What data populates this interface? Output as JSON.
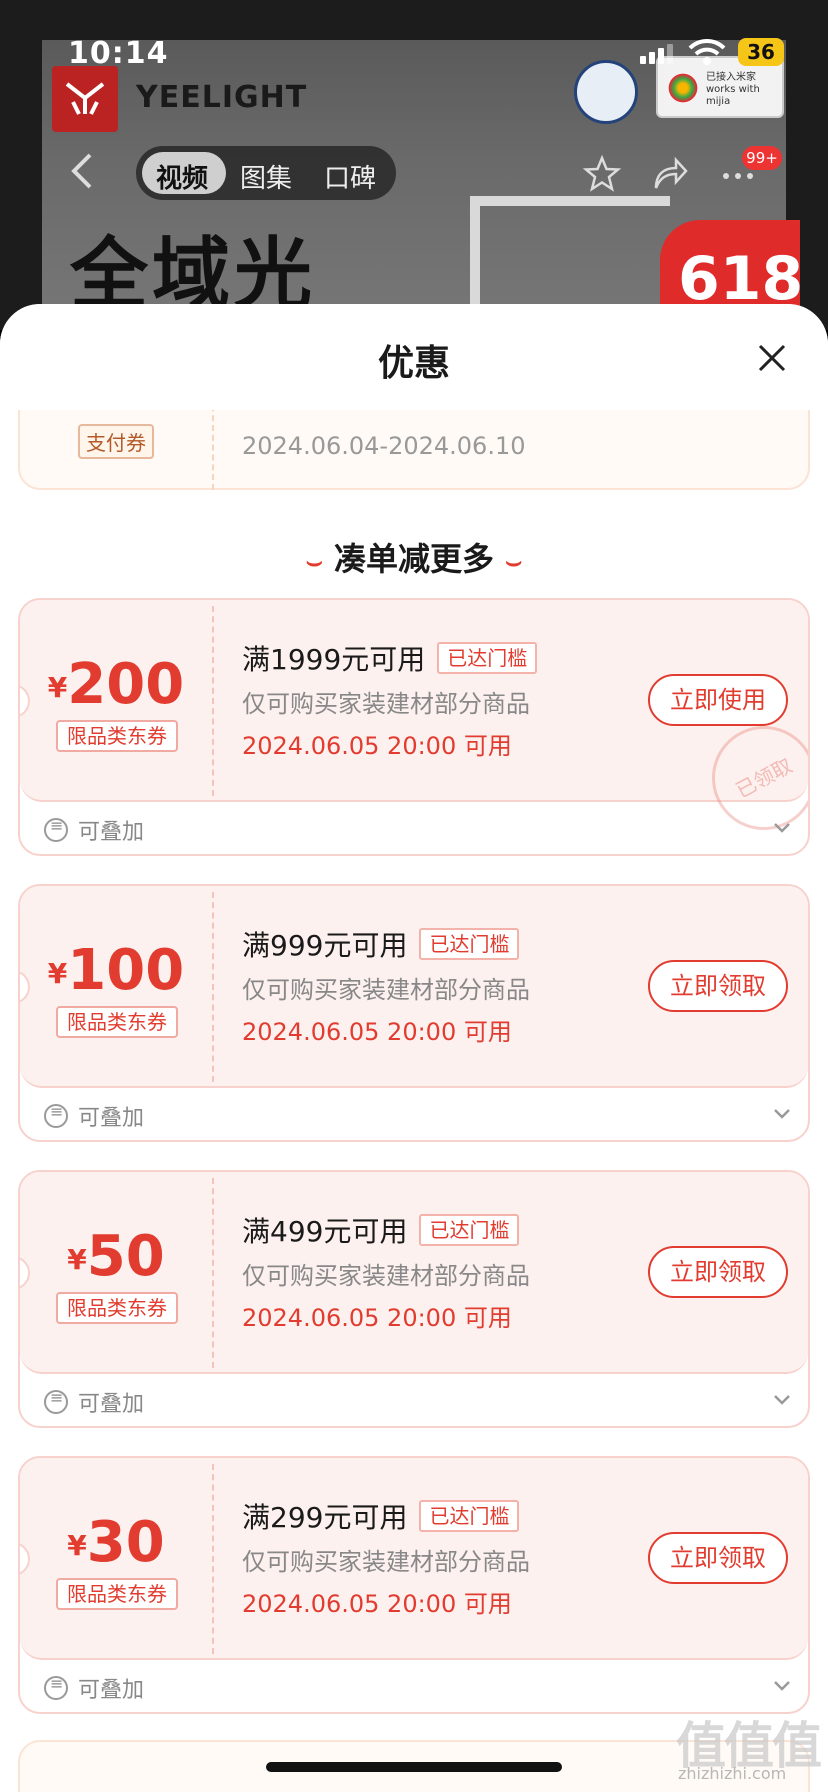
{
  "status": {
    "time": "10:14",
    "battery": "36"
  },
  "product": {
    "brand": "YEELIGHT",
    "certification": "works with mijia",
    "certification_sub": "已接入米家",
    "tabs": [
      {
        "label": "视频"
      },
      {
        "label": "图集"
      },
      {
        "label": "口碑"
      }
    ],
    "notifications": "99+",
    "banner_text": "全域光",
    "promo": "618"
  },
  "sheet": {
    "title": "优惠",
    "partial_card": {
      "tag": "支付券",
      "date": "2024.06.04-2024.06.10"
    },
    "section_title": "凑单减更多",
    "coupons": [
      {
        "currency": "¥",
        "amount": "200",
        "type": "限品类东券",
        "condition": "满1999元可用",
        "threshold": "已达门槛",
        "scope": "仅可购买家装建材部分商品",
        "valid_from": "2024.06.05 20:00 可用",
        "action": "立即使用",
        "stamp": "已领取",
        "stackable": "可叠加"
      },
      {
        "currency": "¥",
        "amount": "100",
        "type": "限品类东券",
        "condition": "满999元可用",
        "threshold": "已达门槛",
        "scope": "仅可购买家装建材部分商品",
        "valid_from": "2024.06.05 20:00 可用",
        "action": "立即领取",
        "stackable": "可叠加"
      },
      {
        "currency": "¥",
        "amount": "50",
        "type": "限品类东券",
        "condition": "满499元可用",
        "threshold": "已达门槛",
        "scope": "仅可购买家装建材部分商品",
        "valid_from": "2024.06.05 20:00 可用",
        "action": "立即领取",
        "stackable": "可叠加"
      },
      {
        "currency": "¥",
        "amount": "30",
        "type": "限品类东券",
        "condition": "满299元可用",
        "threshold": "已达门槛",
        "scope": "仅可购买家装建材部分商品",
        "valid_from": "2024.06.05 20:00 可用",
        "action": "立即领取",
        "stackable": "可叠加"
      }
    ]
  },
  "watermark": {
    "text": "值值值",
    "domain": "zhizhizhi.com"
  },
  "icons": {
    "back": "chevron-left-icon",
    "star": "star-icon",
    "share": "share-icon",
    "more": "more-dots-icon",
    "close": "close-icon",
    "stack": "stack-icon",
    "expand": "chevron-down-icon"
  },
  "colors": {
    "accent": "#e13c2f",
    "coupon_bg": "#fdf1ef",
    "muted": "#888888"
  }
}
